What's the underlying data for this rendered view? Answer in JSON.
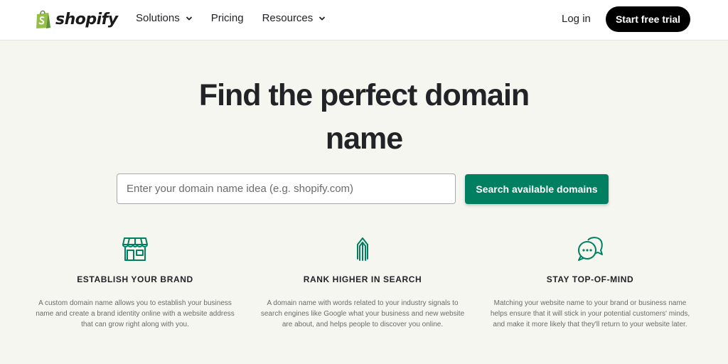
{
  "header": {
    "logo_text": "shopify",
    "nav": [
      {
        "label": "Solutions",
        "has_dropdown": true
      },
      {
        "label": "Pricing",
        "has_dropdown": false
      },
      {
        "label": "Resources",
        "has_dropdown": true
      }
    ],
    "login_label": "Log in",
    "trial_label": "Start free trial"
  },
  "hero": {
    "title_line1": "Find the perfect domain",
    "title_line2": "name",
    "search_placeholder": "Enter your domain name idea (e.g. shopify.com)",
    "search_value": "",
    "search_button": "Search available domains"
  },
  "features": [
    {
      "icon": "storefront-icon",
      "title": "ESTABLISH YOUR BRAND",
      "text_lines": [
        "A custom domain name allows you to establish your business",
        "name and create a brand identity online with a website address",
        "that can grow right along with you."
      ]
    },
    {
      "icon": "arrows-up-icon",
      "title": "RANK HIGHER IN SEARCH",
      "text_lines": [
        "A domain name with words related to your industry signals to",
        "search engines like Google what your business and new website",
        "are about, and helps people to discover you online."
      ]
    },
    {
      "icon": "chat-bubbles-icon",
      "title": "STAY TOP-OF-MIND",
      "text_lines": [
        "Matching your website name to your brand or business name",
        "helps ensure that it will stick in your potential customers' minds,",
        "and make it more likely that they'll return to your website later."
      ]
    }
  ],
  "colors": {
    "brand_green": "#008060",
    "logo_green": "#95bf47",
    "background": "#f6f6f1",
    "text_dark": "#212326",
    "text_muted": "#6b6b6b"
  }
}
